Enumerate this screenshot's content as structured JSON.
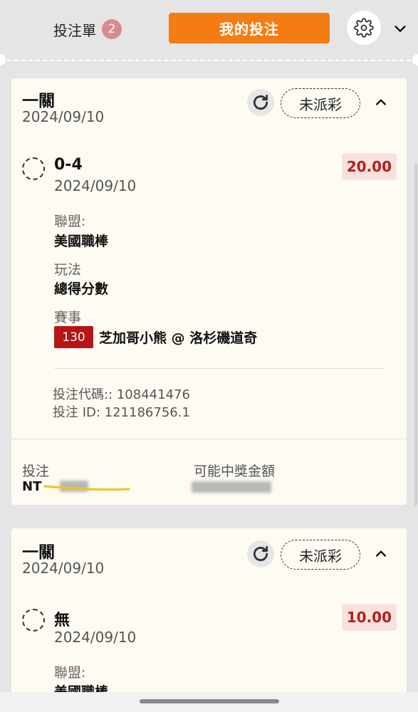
{
  "header": {
    "slip_tab_label": "投注單",
    "slip_count": "2",
    "my_bets_label": "我的投注",
    "settings_icon": "gear-icon",
    "expand_icon": "chevron-down-icon"
  },
  "colors": {
    "accent_orange": "#f57c12",
    "odds_red": "#b21f1f",
    "event_badge_red": "#b51515",
    "count_badge": "#d98a8c"
  },
  "bets": [
    {
      "leg_type": "一關",
      "date": "2024/09/10",
      "status": "未派彩",
      "selection": "0-4",
      "selection_date": "2024/09/10",
      "odds": "20.00",
      "league_label": "聯盟:",
      "league": "美國職棒",
      "market_label": "玩法",
      "market": "總得分數",
      "event_label": "賽事",
      "event_number": "130",
      "event_name": "芝加哥小熊 @ 洛杉磯道奇",
      "bet_code_line": "投注代碼:: 108441476",
      "bet_id_line": "投注 ID: 121186756.1",
      "stake_label": "投注",
      "stake_value_prefix": "NT",
      "payout_label": "可能中獎金額"
    },
    {
      "leg_type": "一關",
      "date": "2024/09/10",
      "status": "未派彩",
      "selection": "無",
      "selection_date": "2024/09/10",
      "odds": "10.00",
      "league_label": "聯盟:",
      "league": "美國職棒"
    }
  ]
}
